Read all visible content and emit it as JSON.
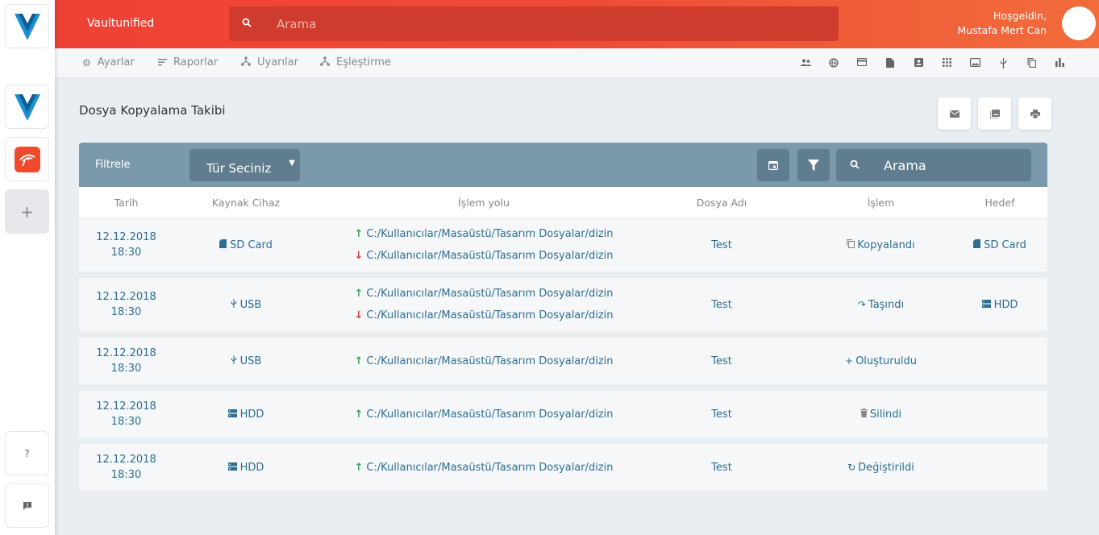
{
  "brand": "Vaultunified",
  "header": {
    "search_placeholder": "Arama",
    "welcome_line1": "Hoşgeldin,",
    "welcome_line2": "Mustafa Mert Can"
  },
  "subnav": {
    "items": [
      {
        "label": "Ayarlar",
        "icon": "gear-icon"
      },
      {
        "label": "Raporlar",
        "icon": "list-icon"
      },
      {
        "label": "Uyarılar",
        "icon": "tree-icon"
      },
      {
        "label": "Eşleştirme",
        "icon": "tree-icon"
      }
    ]
  },
  "page": {
    "title": "Dosya Kopyalama Takibi"
  },
  "filter": {
    "label": "Filtrele",
    "type_select": "Tür Seciniz",
    "search_placeholder": "Arama"
  },
  "table": {
    "headers": [
      "Tarih",
      "Kaynak Cihaz",
      "İşlem yolu",
      "Dosya Adı",
      "İşlem",
      "Hedef"
    ],
    "rows": [
      {
        "date": "12.12.2018",
        "time": "18:30",
        "source": "SD Card",
        "source_icon": "sd-card-icon",
        "path_up": "C:/Kullanıcılar/Masaüstü/Tasarım Dosyalar/dizin",
        "path_down": "C:/Kullanıcılar/Masaüstü/Tasarım Dosyalar/dizin",
        "file": "Test",
        "op": "Kopyalandı",
        "op_icon": "copy-icon",
        "target": "SD Card",
        "target_icon": "sd-card-icon"
      },
      {
        "date": "12.12.2018",
        "time": "18:30",
        "source": "USB",
        "source_icon": "usb-icon",
        "path_up": "C:/Kullanıcılar/Masaüstü/Tasarım Dosyalar/dizin",
        "path_down": "C:/Kullanıcılar/Masaüstü/Tasarım Dosyalar/dizin",
        "file": "Test",
        "op": "Taşındı",
        "op_icon": "redo-icon",
        "target": "HDD",
        "target_icon": "hdd-icon"
      },
      {
        "date": "12.12.2018",
        "time": "18:30",
        "source": "USB",
        "source_icon": "usb-icon",
        "path_up": "C:/Kullanıcılar/Masaüstü/Tasarım Dosyalar/dizin",
        "file": "Test",
        "op": "Oluşturuldu",
        "op_icon": "plus-icon"
      },
      {
        "date": "12.12.2018",
        "time": "18:30",
        "source": "HDD",
        "source_icon": "hdd-icon",
        "path_up": "C:/Kullanıcılar/Masaüstü/Tasarım Dosyalar/dizin",
        "file": "Test",
        "op": "Silindi",
        "op_icon": "trash-icon"
      },
      {
        "date": "12.12.2018",
        "time": "18:30",
        "source": "HDD",
        "source_icon": "hdd-icon",
        "path_up": "C:/Kullanıcılar/Masaüstü/Tasarım Dosyalar/dizin",
        "file": "Test",
        "op": "Değiştirildi",
        "op_icon": "refresh-icon"
      }
    ]
  },
  "colors": {
    "header_start": "#ef4136",
    "header_end": "#f26c3b",
    "filter_bar": "#7a9aac",
    "filter_controls": "#607d8f",
    "link": "#2d6e93",
    "up_arrow": "#3aa55a",
    "down_arrow": "#d9423a"
  }
}
